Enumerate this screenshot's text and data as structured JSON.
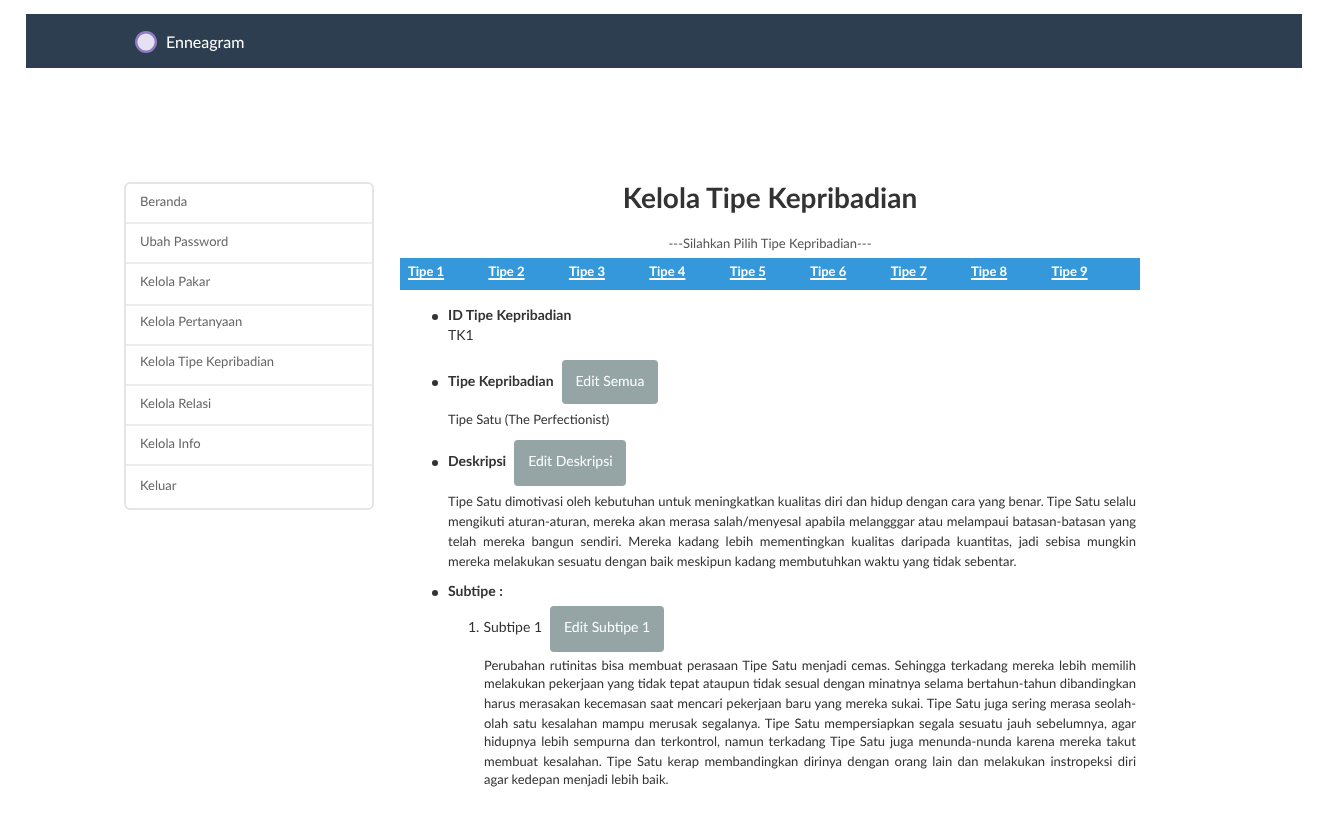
{
  "navbar": {
    "brand": "Enneagram"
  },
  "sidebar": {
    "items": [
      "Beranda",
      "Ubah Password",
      "Kelola Pakar",
      "Kelola Pertanyaan",
      "Kelola Tipe Kepribadian",
      "Kelola Relasi",
      "Kelola Info",
      "Keluar"
    ]
  },
  "page_title": "Kelola Tipe Kepribadian",
  "tab_hint": "---Silahkan Pilih Tipe Kepribadian---",
  "tabs": [
    "Tipe 1",
    "Tipe 2",
    "Tipe 3",
    "Tipe 4",
    "Tipe 5",
    "Tipe 6",
    "Tipe 7",
    "Tipe 8",
    "Tipe 9"
  ],
  "sections": [
    {
      "kind": "plain",
      "label": "ID Tipe Kepribadian",
      "value": "TK1"
    },
    {
      "kind": "button",
      "label": "Tipe Kepribadian",
      "button": "Edit Semua",
      "value": "Tipe Satu (The Perfectionist)"
    },
    {
      "kind": "button",
      "label": "Deskripsi",
      "button": "Edit Deskripsi",
      "value": "Tipe Satu dimotivasi oleh kebutuhan untuk meningkatkan kualitas diri dan hidup dengan cara yang benar. Tipe Satu selalu mengikuti aturan-aturan, mereka akan merasa salah/menyesal apabila melangggar atau melampaui batasan-batasan yang telah mereka bangun sendiri. Mereka kadang lebih mementingkan kualitas daripada kuantitas, jadi sebisa mungkin mereka melakukan sesuatu dengan baik meskipun kadang membutuhkan waktu yang tidak sebentar."
    },
    {
      "kind": "list",
      "label": "Subtipe :",
      "items": [
        {
          "number": "1.",
          "label": "Subtipe 1",
          "button": "Edit Subtipe 1",
          "value": "Perubahan rutinitas bisa membuat perasaan Tipe Satu menjadi cemas. Sehingga terkadang mereka lebih memilih melakukan pekerjaan yang tidak tepat ataupun tidak sesual dengan minatnya selama bertahun-tahun dibandingkan harus merasakan kecemasan saat mencari pekerjaan baru yang mereka sukai. Tipe Satu juga sering merasa seolah-olah satu kesalahan mampu merusak segalanya. Tipe Satu mempersiapkan segala sesuatu jauh sebelumnya, agar hidupnya lebih sempurna dan terkontrol, namun terkadang Tipe Satu juga menunda-nunda karena mereka takut membuat kesalahan. Tipe Satu kerap membandingkan dirinya dengan orang lain dan melakukan instropeksi diri agar kedepan menjadi lebih baik."
        }
      ]
    }
  ]
}
